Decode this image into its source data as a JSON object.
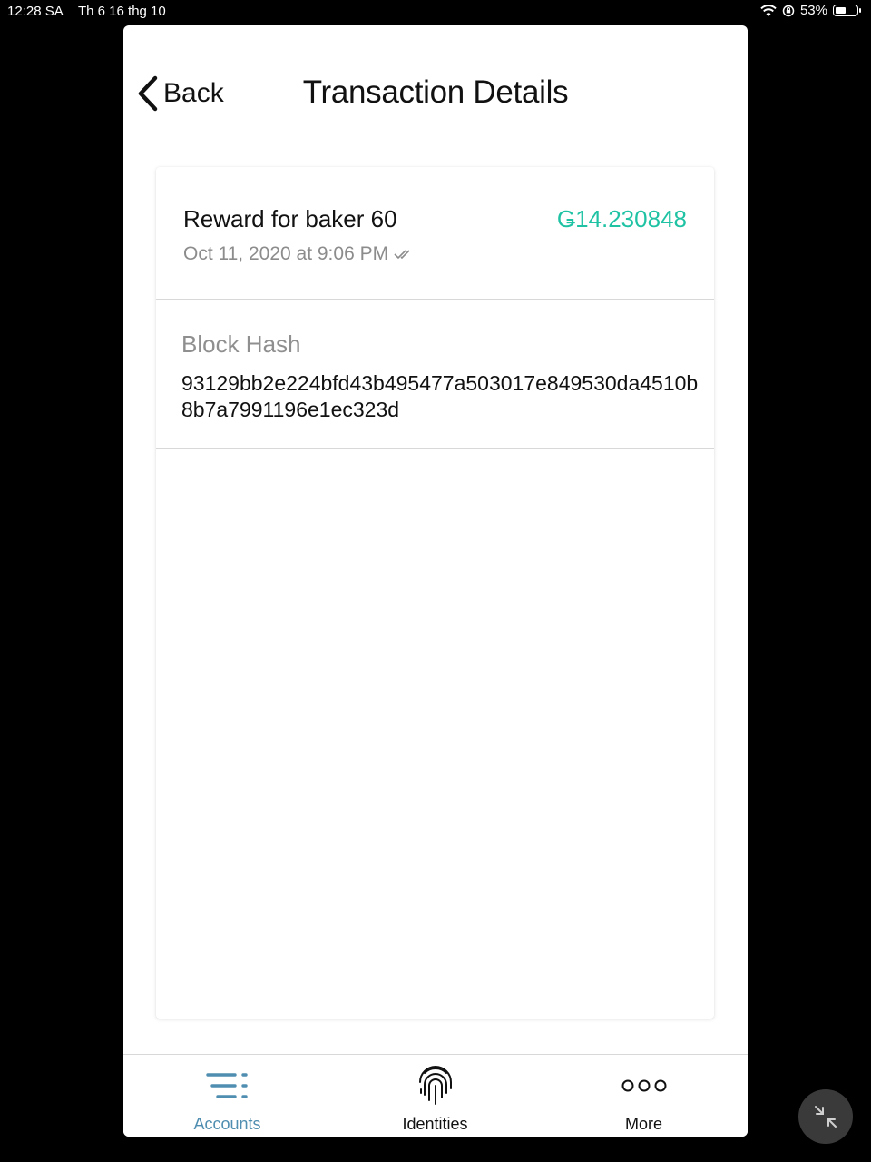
{
  "status_bar": {
    "time": "12:28 SA",
    "date": "Th 6 16 thg 10",
    "battery": "53%",
    "battery_level": 0.53
  },
  "nav": {
    "back_label": "Back",
    "title": "Transaction Details"
  },
  "transaction": {
    "title": "Reward for baker 60",
    "amount": "Ǥ14.230848",
    "date": "Oct 11, 2020 at 9:06 PM",
    "amount_color": "#1fc3a4"
  },
  "block_hash": {
    "label": "Block Hash",
    "value": "93129bb2e224bfd43b495477a503017e849530da4510b8b7a7991196e1ec323d"
  },
  "tabbar": {
    "items": [
      {
        "label": "Accounts",
        "icon": "accounts-list-icon",
        "active": true
      },
      {
        "label": "Identities",
        "icon": "fingerprint-icon",
        "active": false
      },
      {
        "label": "More",
        "icon": "more-dots-icon",
        "active": false
      }
    ],
    "active_color": "#4f8eb0"
  }
}
